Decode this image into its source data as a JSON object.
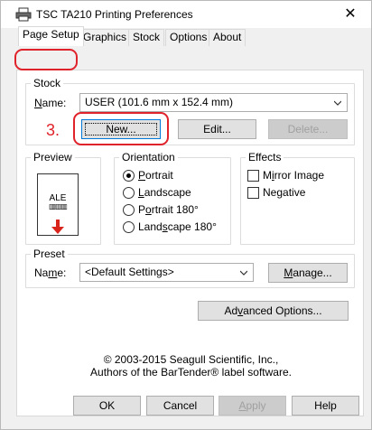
{
  "window": {
    "title": "TSC TA210 Printing Preferences",
    "close_glyph": "✕"
  },
  "tabs": [
    {
      "label": "Page Setup",
      "active": true
    },
    {
      "label": "Graphics"
    },
    {
      "label": "Stock"
    },
    {
      "label": "Options"
    },
    {
      "label": "About"
    }
  ],
  "stock": {
    "group_label": "Stock",
    "name_label": "Name:",
    "name_value": "USER (101.6 mm x 152.4 mm)",
    "new_button": "New...",
    "edit_button": "Edit...",
    "delete_button": "Delete...",
    "step_annotation": "3."
  },
  "preview": {
    "group_label": "Preview",
    "sample_text": "ALE",
    "barcode_glyph": "▥▥▥"
  },
  "orientation": {
    "group_label": "Orientation",
    "options": [
      "Portrait",
      "Landscape",
      "Portrait 180°",
      "Landscape 180°"
    ],
    "selected": "Portrait"
  },
  "effects": {
    "group_label": "Effects",
    "options": [
      "Mirror Image",
      "Negative"
    ]
  },
  "preset": {
    "group_label": "Preset",
    "name_label": "Name:",
    "name_value": "<Default Settings>",
    "manage_button": "Manage..."
  },
  "advanced_button": "Advanced Options...",
  "copyright": {
    "line1": "© 2003-2015 Seagull Scientific, Inc.,",
    "line2": "Authors of the BarTender® label software."
  },
  "footer": {
    "ok": "OK",
    "cancel": "Cancel",
    "apply": "Apply",
    "help": "Help"
  },
  "colors": {
    "annotation_red": "#e0232b",
    "focus_blue": "#0078d7",
    "arrow_red": "#d9241c"
  }
}
